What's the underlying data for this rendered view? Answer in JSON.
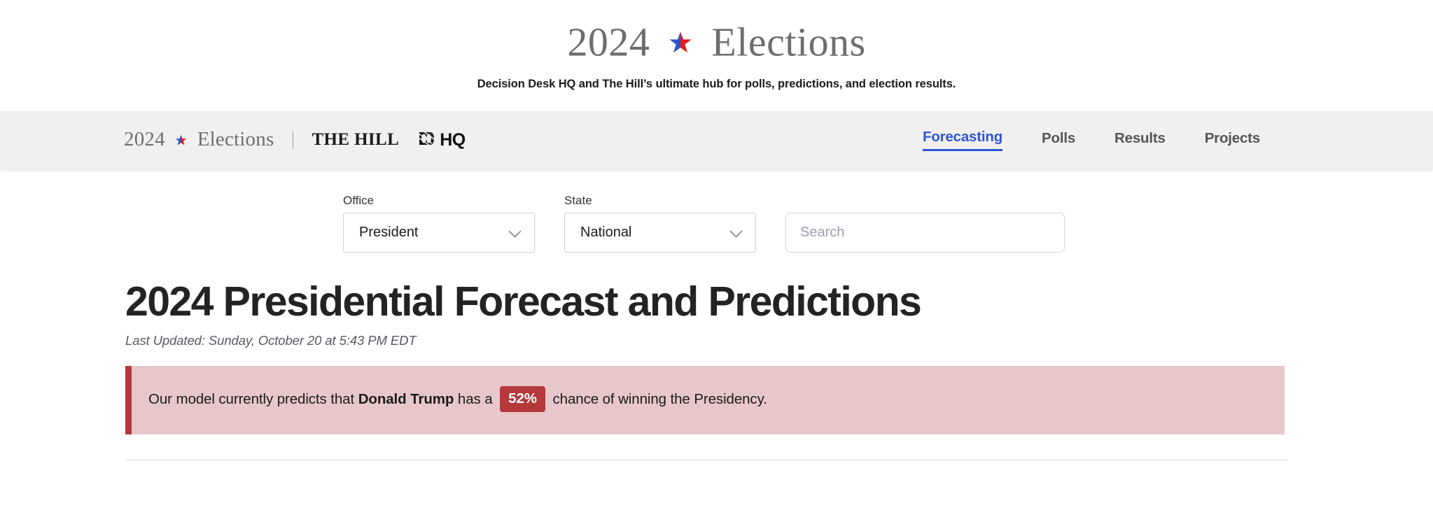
{
  "masthead": {
    "year": "2024",
    "word": "Elections",
    "subtitle": "Decision Desk HQ and The Hill’s ultimate hub for polls, predictions, and election results.",
    "star_blue": "#2b55c8",
    "star_red": "#e8191b"
  },
  "nav": {
    "brand_year": "2024",
    "brand_word": "Elections",
    "publisher": "THE HILL",
    "logo_text": "HQ",
    "links": [
      {
        "label": "Forecasting",
        "active": true
      },
      {
        "label": "Polls",
        "active": false
      },
      {
        "label": "Results",
        "active": false
      },
      {
        "label": "Projects",
        "active": false
      }
    ],
    "active_color": "#2f55d4"
  },
  "filters": {
    "office": {
      "label": "Office",
      "value": "President"
    },
    "state": {
      "label": "State",
      "value": "National"
    },
    "search": {
      "value": "",
      "placeholder": "Search"
    }
  },
  "main": {
    "title": "2024 Presidential Forecast and Predictions",
    "last_updated": "Last Updated: Sunday, October 20 at 5:43 PM EDT",
    "callout": {
      "lead": "Our model currently predicts that",
      "candidate": "Donald Trump",
      "middle": "has a",
      "percent": "52%",
      "tail": "chance of winning the Presidency.",
      "bg_color": "#e8c7ca",
      "accent_color": "#b5383b"
    }
  }
}
